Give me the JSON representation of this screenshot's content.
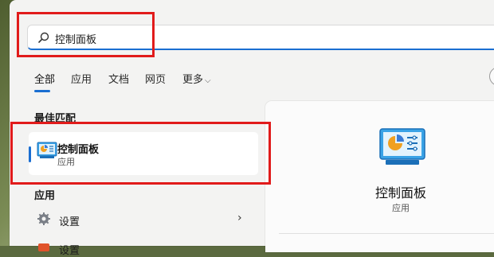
{
  "search": {
    "query": "控制面板"
  },
  "tabs": [
    {
      "label": "全部"
    },
    {
      "label": "应用"
    },
    {
      "label": "文档"
    },
    {
      "label": "网页"
    },
    {
      "label": "更多"
    }
  ],
  "best_match": {
    "section_title": "最佳匹配",
    "title": "控制面板",
    "subtitle": "应用"
  },
  "apps": {
    "section_title": "应用",
    "items": [
      {
        "label": "设置",
        "icon": "gear-icon"
      },
      {
        "label": "设置",
        "icon": "app-icon"
      }
    ]
  },
  "detail": {
    "title": "控制面板",
    "subtitle": "应用"
  },
  "colors": {
    "accent": "#1a6ed1",
    "highlight": "#e11b1b"
  }
}
